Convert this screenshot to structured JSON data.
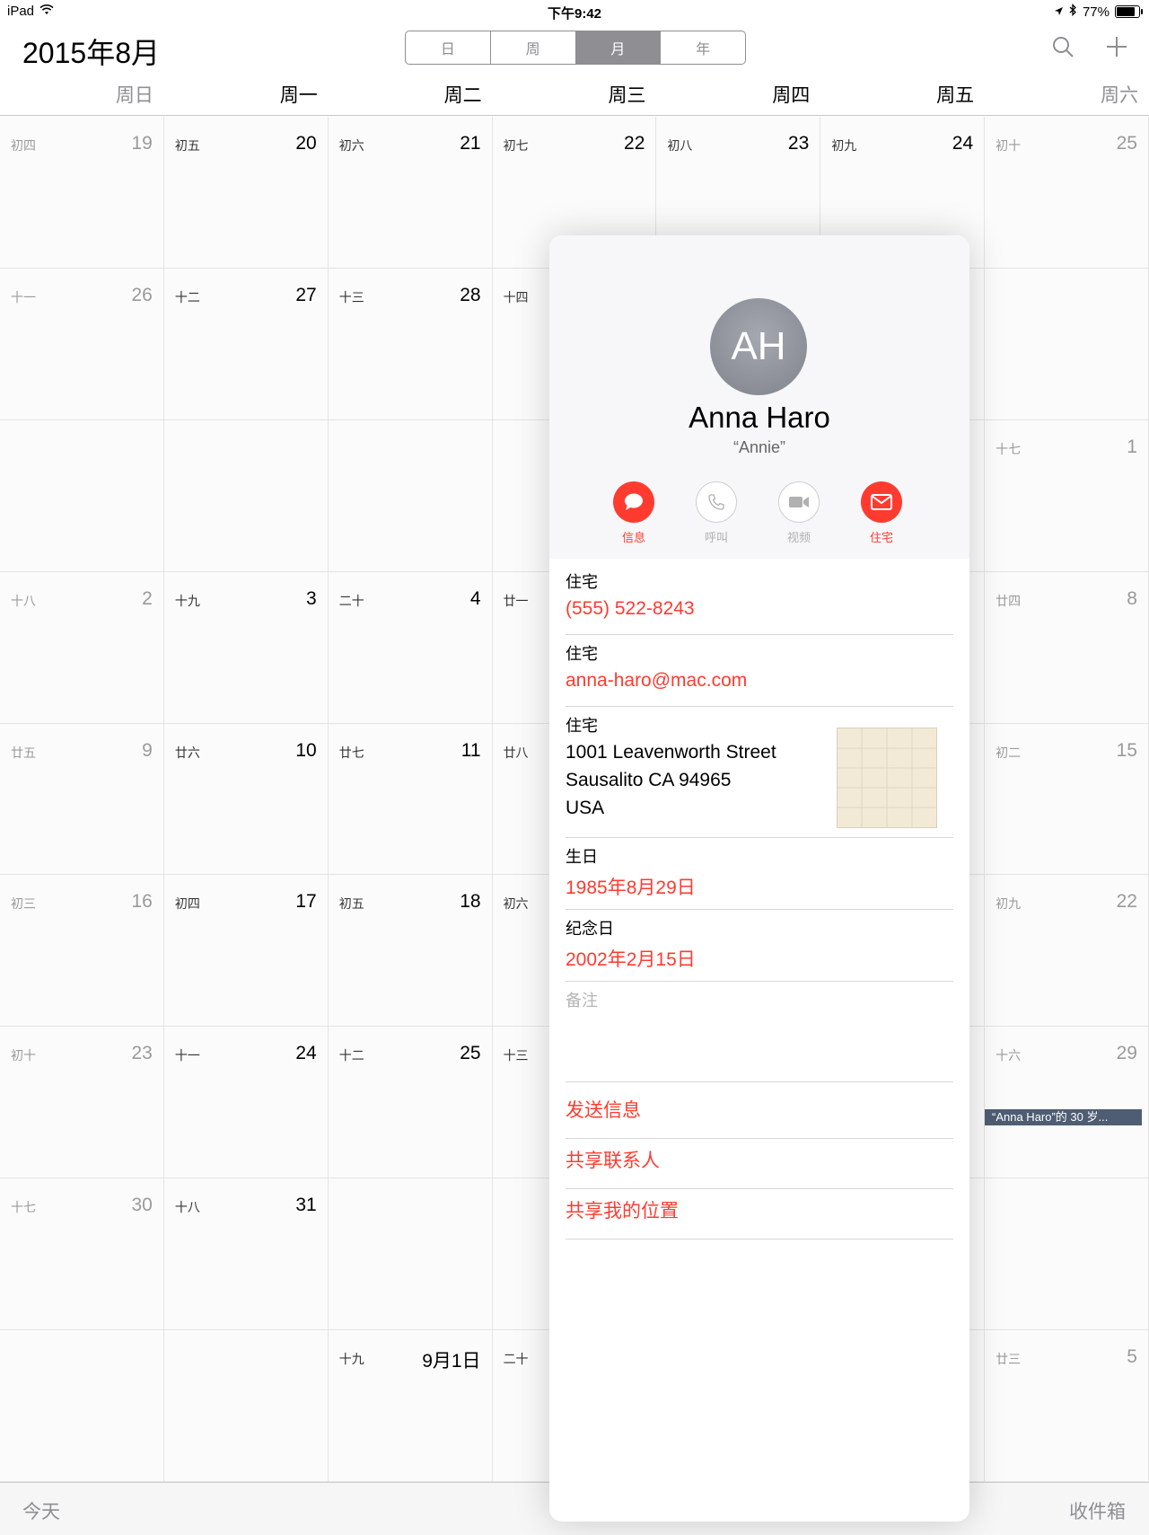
{
  "status": {
    "device": "iPad",
    "time": "下午9:42",
    "battery": "77%"
  },
  "header": {
    "month_title": "2015年8月",
    "segments": [
      "日",
      "周",
      "月",
      "年"
    ]
  },
  "weekdays": [
    "周日",
    "周一",
    "周二",
    "周三",
    "周四",
    "周五",
    "周六"
  ],
  "calendar": {
    "rows": [
      [
        {
          "lunar": "初四",
          "day": "19"
        },
        {
          "lunar": "初五",
          "day": "20"
        },
        {
          "lunar": "初六",
          "day": "21"
        },
        {
          "lunar": "初七",
          "day": "22"
        },
        {
          "lunar": "初八",
          "day": "23"
        },
        {
          "lunar": "初九",
          "day": "24"
        },
        {
          "lunar": "初十",
          "day": "25"
        }
      ],
      [
        {
          "lunar": "十一",
          "day": "26"
        },
        {
          "lunar": "十二",
          "day": "27"
        },
        {
          "lunar": "十三",
          "day": "28"
        },
        {
          "lunar": "十四",
          "day": ""
        },
        {
          "lunar": "",
          "day": ""
        },
        {
          "lunar": "",
          "day": ""
        },
        {
          "lunar": "",
          "day": ""
        }
      ],
      [
        {
          "lunar": "",
          "day": ""
        },
        {
          "lunar": "",
          "day": ""
        },
        {
          "lunar": "",
          "day": ""
        },
        {
          "lunar": "",
          "day": ""
        },
        {
          "lunar": "",
          "day": ""
        },
        {
          "lunar": "",
          "day": ""
        },
        {
          "lunar": "十七",
          "day": "1"
        }
      ],
      [
        {
          "lunar": "十八",
          "day": "2"
        },
        {
          "lunar": "十九",
          "day": "3"
        },
        {
          "lunar": "二十",
          "day": "4"
        },
        {
          "lunar": "廿一",
          "day": ""
        },
        {
          "lunar": "",
          "day": ""
        },
        {
          "lunar": "",
          "day": ""
        },
        {
          "lunar": "廿四",
          "day": "8"
        }
      ],
      [
        {
          "lunar": "廿五",
          "day": "9"
        },
        {
          "lunar": "廿六",
          "day": "10"
        },
        {
          "lunar": "廿七",
          "day": "11"
        },
        {
          "lunar": "廿八",
          "day": ""
        },
        {
          "lunar": "",
          "day": ""
        },
        {
          "lunar": "",
          "day": ""
        },
        {
          "lunar": "初二",
          "day": "15"
        }
      ],
      [
        {
          "lunar": "初三",
          "day": "16"
        },
        {
          "lunar": "初四",
          "day": "17"
        },
        {
          "lunar": "初五",
          "day": "18"
        },
        {
          "lunar": "初六",
          "day": ""
        },
        {
          "lunar": "",
          "day": ""
        },
        {
          "lunar": "",
          "day": ""
        },
        {
          "lunar": "初九",
          "day": "22"
        }
      ],
      [
        {
          "lunar": "初十",
          "day": "23"
        },
        {
          "lunar": "十一",
          "day": "24"
        },
        {
          "lunar": "十二",
          "day": "25"
        },
        {
          "lunar": "十三",
          "day": ""
        },
        {
          "lunar": "",
          "day": ""
        },
        {
          "lunar": "",
          "day": ""
        },
        {
          "lunar": "十六",
          "day": "29"
        }
      ],
      [
        {
          "lunar": "十七",
          "day": "30"
        },
        {
          "lunar": "十八",
          "day": "31"
        },
        {
          "lunar": "",
          "day": ""
        },
        {
          "lunar": "",
          "day": ""
        },
        {
          "lunar": "",
          "day": ""
        },
        {
          "lunar": "",
          "day": ""
        },
        {
          "lunar": "",
          "day": ""
        }
      ],
      [
        {
          "lunar": "",
          "day": ""
        },
        {
          "lunar": "",
          "day": ""
        },
        {
          "lunar": "十九",
          "day": "9月1日"
        },
        {
          "lunar": "二十",
          "day": ""
        },
        {
          "lunar": "",
          "day": ""
        },
        {
          "lunar": "",
          "day": ""
        },
        {
          "lunar": "廿三",
          "day": "5"
        }
      ]
    ],
    "event": "“Anna Haro”的 30 岁..."
  },
  "contact": {
    "initials": "AH",
    "name": "Anna Haro",
    "nickname": "“Annie”",
    "actions": [
      {
        "label": "信息",
        "icon": "message-icon",
        "enabled": true
      },
      {
        "label": "呼叫",
        "icon": "phone-icon",
        "enabled": false
      },
      {
        "label": "视频",
        "icon": "video-icon",
        "enabled": false
      },
      {
        "label": "住宅",
        "icon": "mail-icon",
        "enabled": true
      }
    ],
    "phone": {
      "label": "住宅",
      "value": "(555) 522-8243"
    },
    "email": {
      "label": "住宅",
      "value": "anna-haro@mac.com"
    },
    "address": {
      "label": "住宅",
      "line1": "1001  Leavenworth Street",
      "line2": "Sausalito CA 94965",
      "line3": "USA"
    },
    "birthday": {
      "label": "生日",
      "value": "1985年8月29日"
    },
    "anniversary": {
      "label": "纪念日",
      "value": "2002年2月15日"
    },
    "notes_label": "备注",
    "links": [
      "发送信息",
      "共享联系人",
      "共享我的位置"
    ]
  },
  "toolbar": {
    "today": "今天",
    "inbox": "收件箱"
  },
  "colors": {
    "accent": "#ff3b30",
    "segment_active": "#8e8e93",
    "event": "#4e5d72"
  }
}
